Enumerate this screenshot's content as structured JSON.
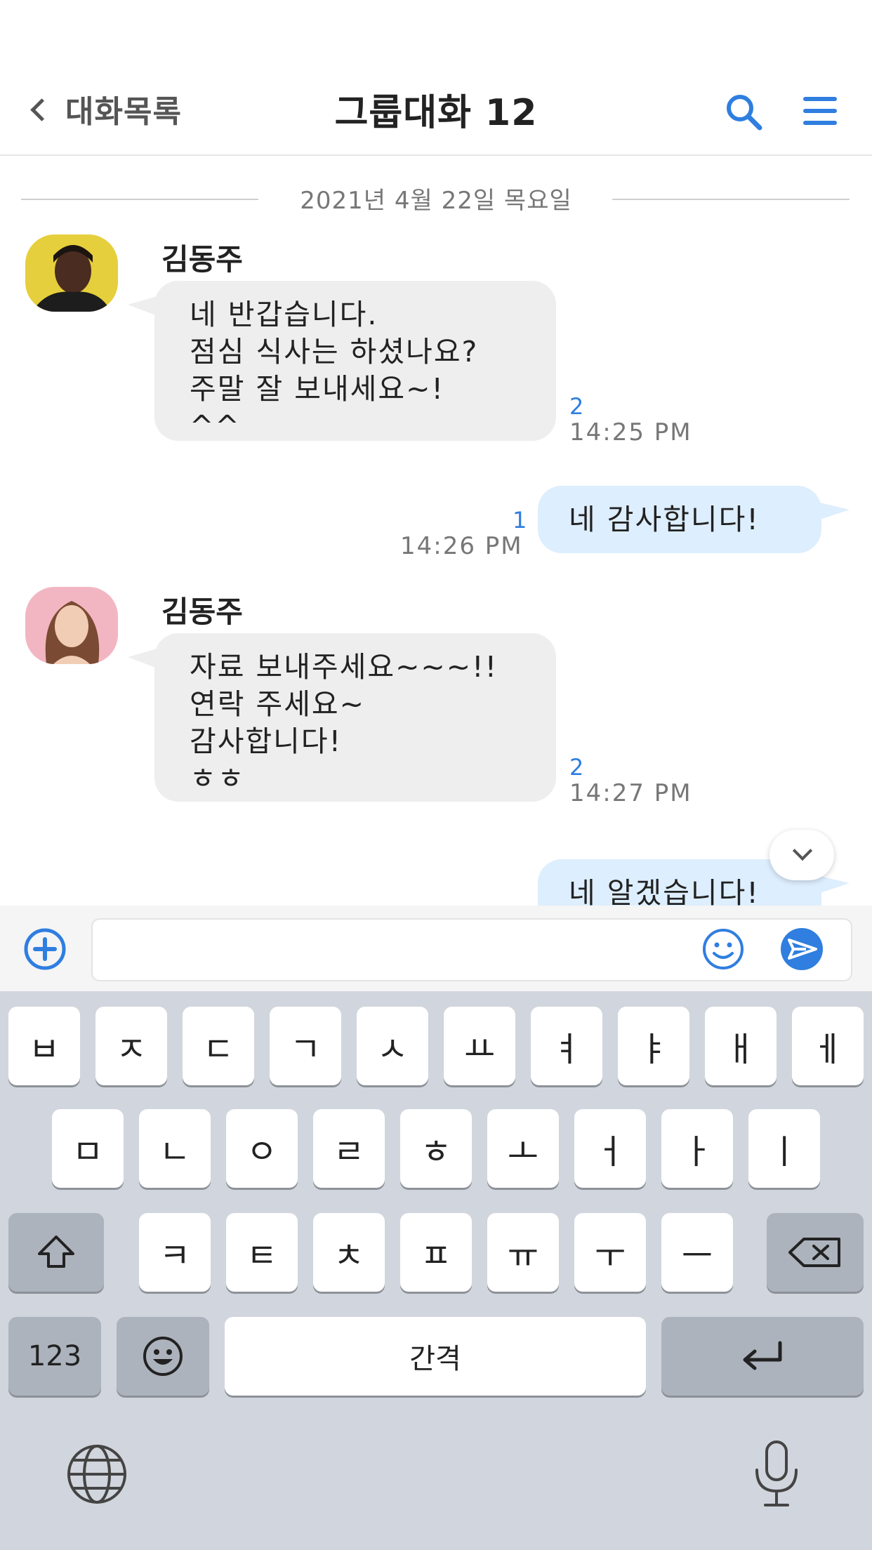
{
  "header": {
    "back_label": "대화목록",
    "title": "그룹대화 12",
    "icons": [
      "search-icon",
      "menu-icon"
    ]
  },
  "colors": {
    "accent": "#2f7ee0",
    "incoming_bubble": "#eeeeee",
    "outgoing_bubble": "#ddeefe",
    "keyboard_bg": "#d1d5dd"
  },
  "chat": {
    "date_divider": "2021년 4월 22일 목요일",
    "messages": [
      {
        "sender": "김동주",
        "lines": [
          "네 반갑습니다.",
          "점심 식사는 하셨나요?",
          "주말 잘 보내세요~!",
          "^^"
        ],
        "unread": "2",
        "time": "14:25 PM"
      },
      {
        "lines": [
          "네 감사합니다!"
        ],
        "unread": "1",
        "time": "14:26 PM"
      },
      {
        "sender": "김동주",
        "lines": [
          "자료 보내주세요~~~!!",
          "연락 주세요~",
          "감사합니다!",
          "ㅎㅎ"
        ],
        "unread": "2",
        "time": "14:27 PM"
      },
      {
        "lines": [
          "네 알겠습니다!"
        ]
      }
    ]
  },
  "input": {
    "placeholder": "",
    "value": ""
  },
  "keyboard": {
    "row1": [
      "ㅂ",
      "ㅈ",
      "ㄷ",
      "ㄱ",
      "ㅅ",
      "ㅛ",
      "ㅕ",
      "ㅑ",
      "ㅐ",
      "ㅔ"
    ],
    "row2": [
      "ㅁ",
      "ㄴ",
      "ㅇ",
      "ㄹ",
      "ㅎ",
      "ㅗ",
      "ㅓ",
      "ㅏ",
      "ㅣ"
    ],
    "row3": [
      "ㅋ",
      "ㅌ",
      "ㅊ",
      "ㅍ",
      "ㅠ",
      "ㅜ",
      "ㅡ"
    ],
    "numbers_label": "123",
    "space_label": "간격"
  }
}
